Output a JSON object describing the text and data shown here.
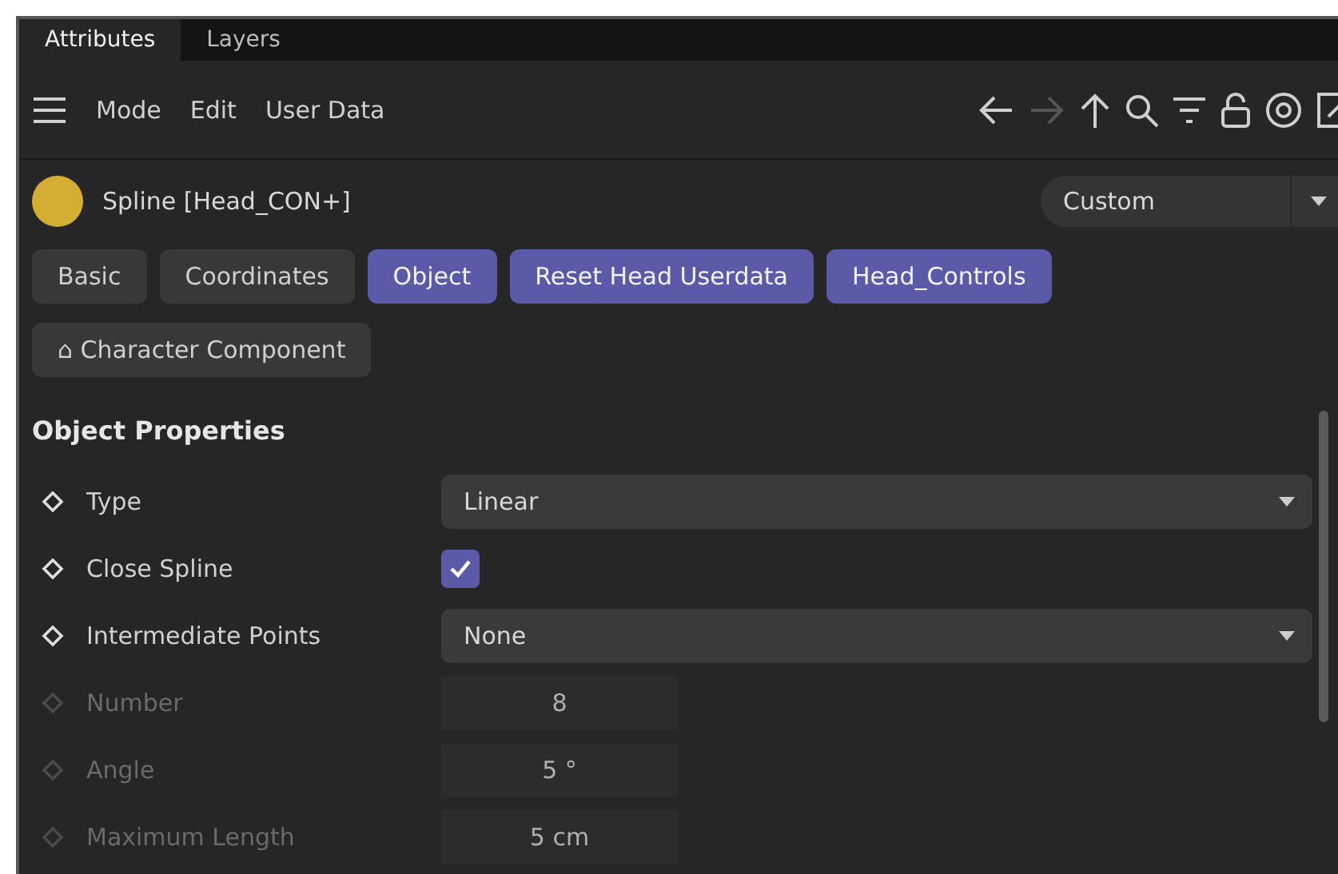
{
  "tabs": [
    {
      "label": "Attributes",
      "selected": true
    },
    {
      "label": "Layers",
      "selected": false
    }
  ],
  "menu": [
    "Mode",
    "Edit",
    "User Data"
  ],
  "object": {
    "name": "Spline [Head_CON+]",
    "color": "#d4ae32",
    "preset": "Custom"
  },
  "groups": [
    {
      "label": "Basic",
      "selected": false
    },
    {
      "label": "Coordinates",
      "selected": false
    },
    {
      "label": "Object",
      "selected": true
    },
    {
      "label": "Reset Head Userdata",
      "selected": true
    },
    {
      "label": "Head_Controls",
      "selected": true
    },
    {
      "label": "⌂ Character Component",
      "selected": false
    }
  ],
  "section": "Object Properties",
  "properties": [
    {
      "kind": "dropdown",
      "label": "Type",
      "value": "Linear",
      "disabled": false
    },
    {
      "kind": "checkbox",
      "label": "Close Spline",
      "checked": true,
      "disabled": false
    },
    {
      "kind": "dropdown",
      "label": "Intermediate Points",
      "value": "None",
      "disabled": false
    },
    {
      "kind": "number",
      "label": "Number",
      "value": "8",
      "disabled": true
    },
    {
      "kind": "number",
      "label": "Angle",
      "value": "5 °",
      "disabled": true
    },
    {
      "kind": "number",
      "label": "Maximum Length",
      "value": "5 cm",
      "disabled": true
    }
  ]
}
